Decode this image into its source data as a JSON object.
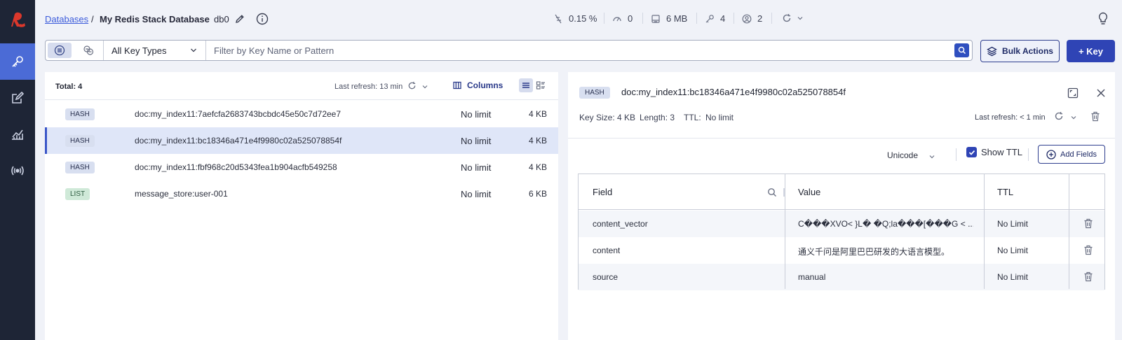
{
  "breadcrumb": {
    "databases_link": "Databases",
    "separator": "/",
    "database_name": "My Redis Stack Database",
    "db_index": "db0"
  },
  "stats": {
    "cpu": "0.15 %",
    "ops": "0",
    "memory": "6 MB",
    "keys": "4",
    "clients": "2"
  },
  "filter": {
    "key_type_selected": "All Key Types",
    "placeholder": "Filter by Key Name or Pattern",
    "bulk_actions_label": "Bulk Actions",
    "add_key_label": "+ Key"
  },
  "key_list": {
    "total_label": "Total: 4",
    "last_refresh": "Last refresh: 13 min",
    "columns_label": "Columns",
    "rows": [
      {
        "type": "HASH",
        "name": "doc:my_index11:7aefcfa2683743bcbdc45e50c7d72ee7",
        "ttl": "No limit",
        "size": "4 KB"
      },
      {
        "type": "HASH",
        "name": "doc:my_index11:bc18346a471e4f9980c02a525078854f",
        "ttl": "No limit",
        "size": "4 KB"
      },
      {
        "type": "HASH",
        "name": "doc:my_index11:fbf968c20d5343fea1b904acfb549258",
        "ttl": "No limit",
        "size": "4 KB"
      },
      {
        "type": "LIST",
        "name": "message_store:user-001",
        "ttl": "No limit",
        "size": "6 KB"
      }
    ]
  },
  "detail": {
    "type": "HASH",
    "key_name": "doc:my_index11:bc18346a471e4f9980c02a525078854f",
    "key_size": "Key Size: 4 KB",
    "length": "Length: 3",
    "ttl_label": "TTL:",
    "ttl_value": "No limit",
    "last_refresh": "Last refresh: < 1 min",
    "format_selected": "Unicode",
    "show_ttl_label": "Show TTL",
    "add_fields_label": "Add Fields",
    "headers": {
      "field": "Field",
      "value": "Value",
      "ttl": "TTL"
    },
    "fields": [
      {
        "field": "content_vector",
        "value": "C���XVO< }L� �Q;la���[���G < ...",
        "ttl": "No Limit"
      },
      {
        "field": "content",
        "value": "通义千问是阿里巴巴研发的大语言模型。",
        "ttl": "No Limit"
      },
      {
        "field": "source",
        "value": "manual",
        "ttl": "No Limit"
      }
    ]
  },
  "colors": {
    "sidebar_bg": "#1e2536",
    "sidebar_active": "#4b6bd6",
    "primary": "#2f44b5",
    "logo_red": "#dc382c",
    "page_bg": "#f0f2f8"
  }
}
